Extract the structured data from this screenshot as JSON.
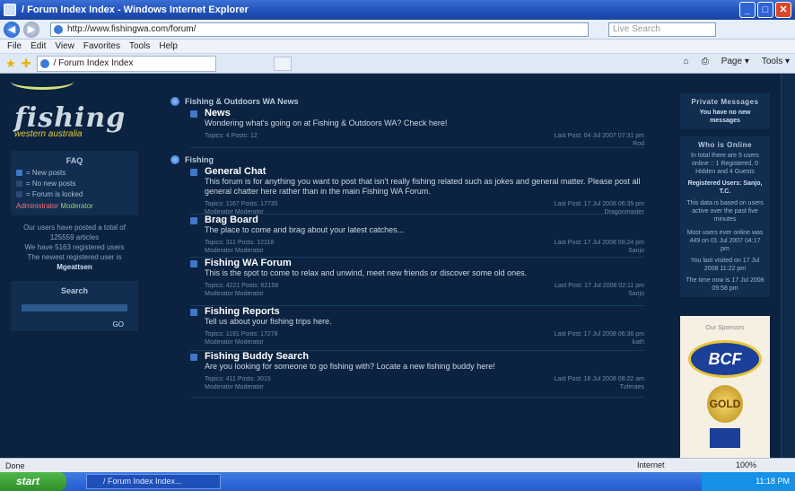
{
  "window": {
    "title": "/ Forum Index Index - Windows Internet Explorer",
    "controls": [
      "_",
      "□",
      "✕"
    ]
  },
  "addressbar": {
    "url": "http://www.fishingwa.com/forum/",
    "search_placeholder": "Live Search"
  },
  "menu": [
    "File",
    "Edit",
    "View",
    "Favorites",
    "Tools",
    "Help"
  ],
  "tab": {
    "label": "/ Forum Index Index"
  },
  "commands": {
    "page": "Page ▾",
    "tools": "Tools ▾"
  },
  "sidebar": {
    "logo_main": "fishing",
    "logo_sub": "western australia",
    "legend_title": "FAQ",
    "legend": [
      "= New posts",
      "= No new posts",
      "= Forum is locked"
    ],
    "roles_admin": "Administrator",
    "roles_mod": "Moderator",
    "stats_1": "Our users have posted a total of 125559 articles",
    "stats_2": "We have 5163 registered users",
    "stats_3": "The newest registered user is",
    "newest_user": "Mgeattsen",
    "search_title": "Search",
    "search_go": "GO"
  },
  "categories": [
    {
      "name": "Fishing & Outdoors WA News",
      "forums": [
        {
          "name": "News",
          "desc": "Wondering what's going on at Fishing & Outdoors WA? Check here!",
          "stats": "Topics: 4  Posts: 12",
          "last_post": "Last Post: 04 Jul 2007 07:31 pm",
          "last_user": "Rod"
        }
      ]
    },
    {
      "name": "Fishing",
      "forums": [
        {
          "name": "General Chat",
          "desc": "This forum is for anything you want to post that isn't really fishing related such as jokes and general matter. Please post all general chatter here rather than in the main Fishing WA Forum.",
          "stats": "Topics: 1167  Posts: 17735",
          "mods": "Moderator Moderator",
          "last_post": "Last Post: 17 Jul 2008 06:35 pm",
          "last_user": "Dragonmaster"
        },
        {
          "name": "Brag Board",
          "desc": "The place to come and brag about your latest catches...",
          "stats": "Topics: 311  Posts: 12118",
          "mods": "Moderator Moderator",
          "last_post": "Last Post: 17 Jul 2008 08:24 pm",
          "last_user": "Sanjo"
        },
        {
          "name": "Fishing WA Forum",
          "desc": "This is the spot to come to relax and unwind, meet new friends or discover some old ones.",
          "stats": "Topics: 4221  Posts: 62158",
          "mods": "Moderator Moderator",
          "last_post": "Last Post: 17 Jul 2008 02:11 pm",
          "last_user": "Sanjo"
        },
        {
          "name": "Fishing Reports",
          "desc": "Tell us about your fishing trips here.",
          "stats": "Topics: 1191  Posts: 17278",
          "mods": "Moderator Moderator",
          "last_post": "Last Post: 17 Jul 2008 06:36 pm",
          "last_user": "kath"
        },
        {
          "name": "Fishing Buddy Search",
          "desc": "Are you looking for someone to go fishing with? Locate a new fishing buddy here!",
          "stats": "Topics: 411  Posts: 3015",
          "mods": "Moderator Moderator",
          "last_post": "Last Post: 16 Jul 2008 08:22 am",
          "last_user": "Tuferaes"
        }
      ]
    }
  ],
  "right": {
    "pm_title": "Private Messages",
    "pm_text": "You have no new messages",
    "online_title": "Who is Online",
    "online_1": "In total there are 5 users online :: 1 Registered, 0 Hidden and 4 Guests",
    "online_2": "Registered Users: Sanjo, T.C.",
    "online_3": "This data is based on users active over the past five minutes",
    "online_4": "Most users ever online was 449 on 01 Jul 2007 04:17 pm",
    "online_5": "You last visited on 17 Jul 2008 11:22 pm",
    "online_6": "The time now is 17 Jul 2008 09:58 pm",
    "sponsors_title": "Our Sponsors",
    "sponsor_1": "BCF",
    "sponsor_2": "GOLD"
  },
  "status": {
    "left": "Done",
    "zone": "Internet",
    "zoom": "100%"
  },
  "taskbar": {
    "start": "start",
    "item": "/ Forum Index Index...",
    "clock": "11:18 PM"
  }
}
